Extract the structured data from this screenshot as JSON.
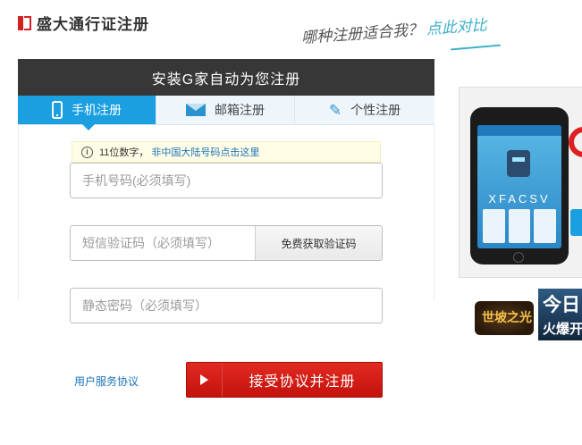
{
  "brand": {
    "name": "盛大通行证注册"
  },
  "slogan": {
    "question": "哪种注册适合我？",
    "link": "点此对比"
  },
  "panel": {
    "title": "安装G家自动为您注册"
  },
  "tabs": [
    {
      "label": "手机注册",
      "icon": "phone-icon",
      "active": true
    },
    {
      "label": "邮箱注册",
      "icon": "mail-icon",
      "active": false
    },
    {
      "label": "个性注册",
      "icon": "brush-icon",
      "active": false
    }
  ],
  "tip": {
    "text": "11位数字，",
    "link": "非中国大陆号码点击这里"
  },
  "form": {
    "phone_placeholder": "手机号码(必须填写)",
    "sms_placeholder": "短信验证码（必须填写）",
    "sms_button": "免费获取验证码",
    "password_placeholder": "静态密码（必须填写）",
    "agreement_link": "用户服务协议",
    "submit_label": "接受协议并注册"
  },
  "ads": {
    "app_screen_text": "XFACSV",
    "game_logo": "世坡之光",
    "game_title": "今日",
    "game_subtitle": "火爆开"
  },
  "colors": {
    "accent_blue": "#1a9fe0",
    "submit_red": "#d01c16",
    "header_dark": "#373737",
    "link_blue": "#1a73b8"
  }
}
